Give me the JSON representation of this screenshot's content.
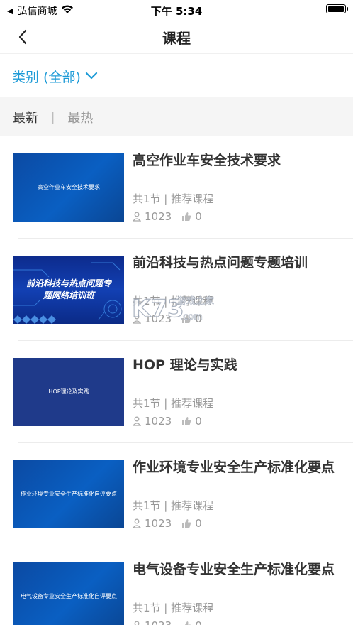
{
  "status_bar": {
    "carrier": "弘信商城",
    "time": "下午 5:34"
  },
  "nav": {
    "title": "课程"
  },
  "filter": {
    "label": "类别 (全部)"
  },
  "sort": {
    "tabs": [
      "最新",
      "最热"
    ],
    "separator": "|"
  },
  "courses": [
    {
      "title": "高空作业车安全技术要求",
      "thumb_text": "高空作业车安全技术要求",
      "meta": "共1节 | 推荐课程",
      "views": "1023",
      "likes": "0"
    },
    {
      "title": "前沿科技与热点问题专题培训",
      "thumb_text": "前沿科技与热点问题专题网络培训班",
      "meta": "共1节 | 推荐课程",
      "views": "1023",
      "likes": "0"
    },
    {
      "title": "HOP 理论与实践",
      "thumb_text": "HOP理论及实践",
      "meta": "共1节 | 推荐课程",
      "views": "1023",
      "likes": "0"
    },
    {
      "title": "作业环境专业安全生产标准化要点",
      "thumb_text": "作业环境专业安全生产标准化自评要点",
      "meta": "共1节 | 推荐课程",
      "views": "1023",
      "likes": "0"
    },
    {
      "title": "电气设备专业安全生产标准化要点",
      "thumb_text": "电气设备专业安全生产标准化自评要点",
      "meta": "共1节 | 推荐课程",
      "views": "1023",
      "likes": "0"
    }
  ],
  "watermark": {
    "brand": "K73",
    "site": "游戏之家",
    "domain": ".com"
  },
  "colors": {
    "accent": "#1e9bd7",
    "thumb_blue": "#0a4fa0",
    "thumb_navy": "#1f3a8a"
  }
}
